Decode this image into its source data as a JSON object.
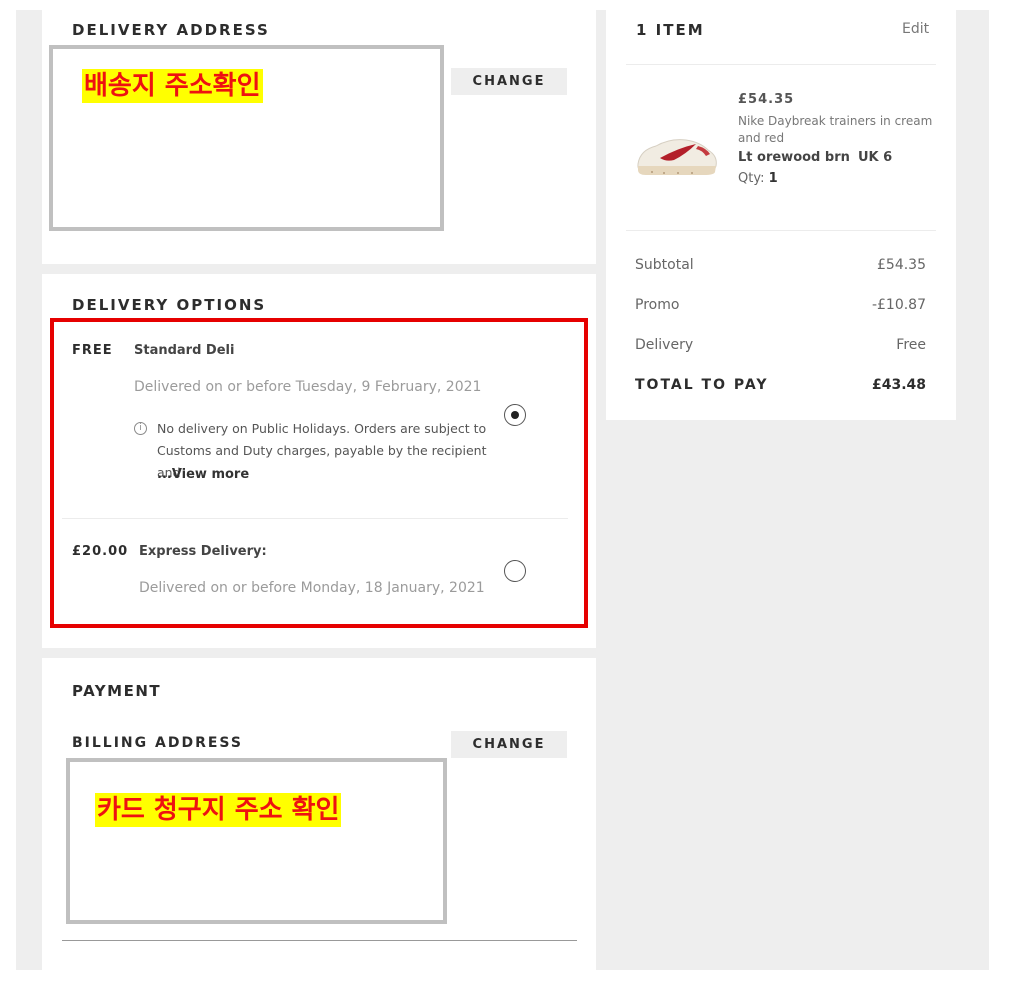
{
  "delivery_address": {
    "title": "DELIVERY ADDRESS",
    "change_label": "CHANGE",
    "annotation": "배송지 주소확인"
  },
  "delivery_options": {
    "title": "DELIVERY OPTIONS",
    "options": [
      {
        "price": "FREE",
        "name": "Standard Deli",
        "date": "Delivered on or before Tuesday, 9 February, 2021",
        "note": "No delivery on Public Holidays. Orders are subject to Customs and Duty charges, payable by the recipient and",
        "view_more": "...View more",
        "selected": true
      },
      {
        "price": "£20.00",
        "name": "Express Delivery:",
        "date": "Delivered on or before Monday, 18 January, 2021",
        "selected": false
      }
    ]
  },
  "payment": {
    "title": "PAYMENT",
    "billing_title": "BILLING ADDRESS",
    "change_label": "CHANGE",
    "annotation": "카드 청구지 주소 확인"
  },
  "summary": {
    "title": "1 ITEM",
    "edit_label": "Edit",
    "item": {
      "price": "£54.35",
      "name": "Nike Daybreak trainers in cream and red",
      "color": "Lt orewood brn",
      "size": "UK 6",
      "qty_label": "Qty:",
      "qty": "1"
    },
    "rows": [
      {
        "label": "Subtotal",
        "value": "£54.35"
      },
      {
        "label": "Promo",
        "value": "-£10.87"
      },
      {
        "label": "Delivery",
        "value": "Free"
      }
    ],
    "total_label": "TOTAL TO PAY",
    "total_value": "£43.48"
  },
  "icons": {
    "info": "info-icon",
    "shoe": "sneaker-image"
  },
  "colors": {
    "annotation_red": "#e60000",
    "annotation_yellow": "#ffff00",
    "page_bg": "#eeeeee"
  }
}
